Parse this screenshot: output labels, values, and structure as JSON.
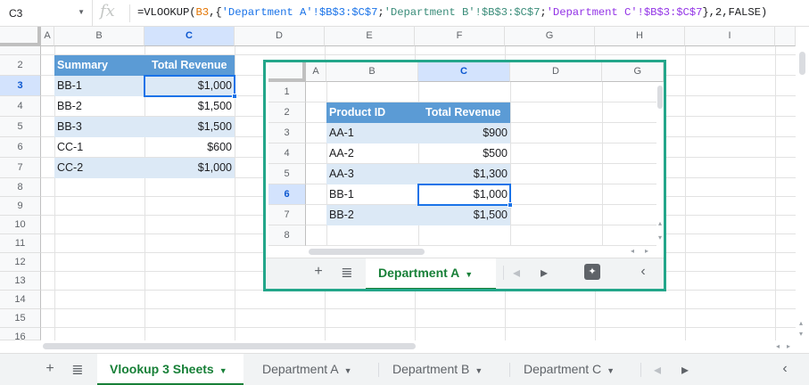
{
  "formula_bar": {
    "cell_ref": "C3",
    "fx_label": "fx",
    "formula_parts": [
      "=VLOOKUP(",
      "B3",
      ",{",
      "'Department A'!$B$3:$C$7",
      ";",
      "'Department B'!$B$3:$C$7",
      ";",
      "'Department C'!$B$3:$C$7",
      "},2,FALSE)"
    ]
  },
  "main_sheet": {
    "columns": [
      "A",
      "B",
      "C",
      "D",
      "E",
      "F",
      "G",
      "H",
      "I"
    ],
    "selected_column": "C",
    "rows": [
      "2",
      "3",
      "4",
      "5",
      "6",
      "7",
      "8",
      "9",
      "10",
      "11",
      "12",
      "13",
      "14",
      "15",
      "16"
    ],
    "selected_row": "3",
    "table": {
      "headers": [
        "Summary",
        "Total Revenue"
      ],
      "rows": [
        [
          "BB-1",
          "$1,000"
        ],
        [
          "BB-2",
          "$1,500"
        ],
        [
          "BB-3",
          "$1,500"
        ],
        [
          "CC-1",
          "$600"
        ],
        [
          "CC-2",
          "$1,000"
        ]
      ]
    }
  },
  "embedded_sheet": {
    "columns": [
      "A",
      "B",
      "C",
      "D",
      "G"
    ],
    "selected_column": "C",
    "rows": [
      "1",
      "2",
      "3",
      "4",
      "5",
      "6",
      "7",
      "8"
    ],
    "selected_row": "6",
    "table": {
      "headers": [
        "Product ID",
        "Total Revenue"
      ],
      "rows": [
        [
          "AA-1",
          "$900"
        ],
        [
          "AA-2",
          "$500"
        ],
        [
          "AA-3",
          "$1,300"
        ],
        [
          "BB-1",
          "$1,000"
        ],
        [
          "BB-2",
          "$1,500"
        ]
      ]
    },
    "tab_label": "Department A",
    "add_symbol": "+",
    "list_symbol": "≣",
    "prev_symbol": "◂",
    "next_symbol": "▸",
    "collapse_symbol": "‹",
    "explore_symbol": "✦"
  },
  "sheet_tabs": {
    "add_symbol": "+",
    "list_symbol": "≣",
    "tabs": [
      {
        "label": "Vlookup 3 Sheets",
        "active": true
      },
      {
        "label": "Department A",
        "active": false
      },
      {
        "label": "Department B",
        "active": false
      },
      {
        "label": "Department C",
        "active": false
      }
    ],
    "caret_symbol": "▼",
    "prev_symbol": "◂",
    "next_symbol": "▸",
    "collapse_symbol": "‹"
  },
  "colors": {
    "header_fill": "#5b9bd5",
    "band_fill": "#dce9f6",
    "selection": "#1a73e8",
    "embed_border": "#23a68a",
    "active_tab": "#188038"
  }
}
